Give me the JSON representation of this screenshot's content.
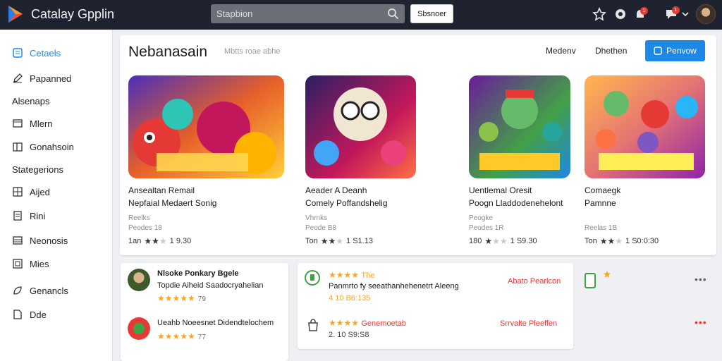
{
  "app": {
    "title": "Catalay Gpplin"
  },
  "search": {
    "placeholder": "Stapbion",
    "button_label": "Sbsnoer"
  },
  "topbar": {
    "notifications_badge": "1",
    "messages_badge": "1"
  },
  "sidebar": {
    "items": [
      {
        "label": "Cetaels",
        "icon": "list-icon",
        "active": true
      },
      {
        "label": "Papanned",
        "icon": "pen-icon"
      },
      {
        "label": "Alsenaps",
        "icon": ""
      },
      {
        "label": "Mlern",
        "icon": "window-icon"
      },
      {
        "label": "Gonahsoin",
        "icon": "book-icon"
      },
      {
        "label": "Stategerions",
        "icon": ""
      },
      {
        "label": "Aijed",
        "icon": "grid-icon"
      },
      {
        "label": "Rini",
        "icon": "document-icon"
      },
      {
        "label": "Neonosis",
        "icon": "table-icon"
      },
      {
        "label": "Mies",
        "icon": "frame-icon"
      },
      {
        "label": "Genancls",
        "icon": "leaf-icon"
      },
      {
        "label": "Dde",
        "icon": "doc-icon"
      }
    ]
  },
  "featured": {
    "title": "Nebanasain",
    "subtitle": "Mbtts roae abhe",
    "sort_options": [
      "Medenv",
      "Dhethen"
    ],
    "primary_button": "Penvow",
    "games": [
      {
        "title": "Ansealtan Remail",
        "subtitle": "Nepfaial Medaert Sonig",
        "meta1": "Reelks",
        "meta2": "Peodes 18",
        "rating_prefix": "1an",
        "rating_value": "1 9.30",
        "stars": 2
      },
      {
        "title": "Aeader A Deanh",
        "subtitle": "Comely Poffandshelig",
        "meta1": "Vhrnks",
        "meta2": "Peode B8",
        "rating_prefix": "Ton",
        "rating_value": "1 S1.13",
        "stars": 2
      },
      {
        "title": "Uentlemal Oresit",
        "subtitle": "Poogn Lladdodenehelont",
        "meta1": "Peogke",
        "meta2": "Peodes 1R",
        "rating_prefix": "180",
        "rating_value": "1 S9.30",
        "stars": 1
      },
      {
        "title": "Comaegk",
        "subtitle": "Pamnne",
        "meta1": "",
        "meta2": "Reelas 1B",
        "rating_prefix": "Ton",
        "rating_value": "1 S0:0:30",
        "stars": 2
      }
    ]
  },
  "reviews": {
    "left": [
      {
        "name": "Nlsoke Ponkary Bgele",
        "text": "Topdie Aiheid Saadocryahelian",
        "rating": "79"
      },
      {
        "name": "Ueahb Noeesnet Didendtelochem",
        "rating": "77"
      }
    ],
    "middle": [
      {
        "stars_label": "The",
        "text": "Panmrto fy seeathanhehenetrt Aleeng",
        "rating": "4 10 B6:135",
        "link": "Abato Pearlcon"
      },
      {
        "name": "Genemoetab",
        "rating": "2. 10 S9:S8",
        "link": "Srrvalte Pleeffen"
      }
    ]
  },
  "colors": {
    "accent": "#1e88e5",
    "topbar": "#1f2330",
    "link_red": "#e53935",
    "star": "#f5a623"
  }
}
